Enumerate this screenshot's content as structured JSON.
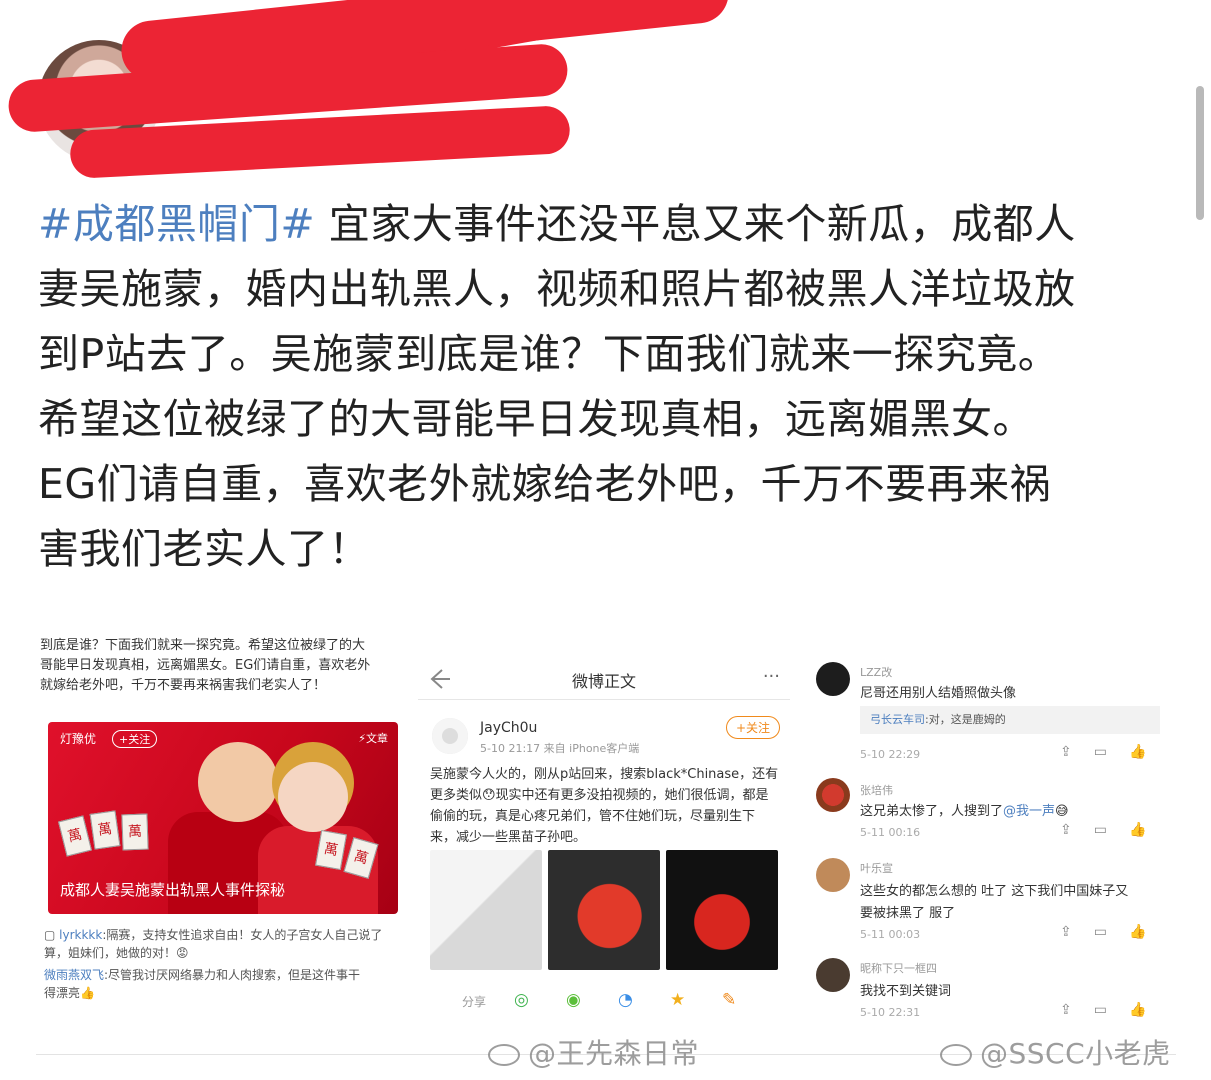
{
  "post": {
    "hashtag": "#成都黑帽门#",
    "lines": [
      " 宜家大事件还没平息又来个新瓜，成都人",
      "妻吴施蒙，婚内出轨黑人，视频和照片都被黑人洋垃圾放",
      "到P站去了。吴施蒙到底是谁？下面我们就来一探究竟。",
      "希望这位被绿了的大哥能早日发现真相，远离媚黑女。",
      "EG们请自重，喜欢老外就嫁给老外吧，千万不要再来祸",
      "害我们老实人了！"
    ]
  },
  "panel_article": {
    "lead_lines": [
      "到底是谁？下面我们就来一探究竟。希望这位被绿了的大",
      "哥能早日发现真相，远离媚黑女。EG们请自重，喜欢老外",
      "就嫁给老外吧，千万不要再来祸害我们老实人了！"
    ],
    "author": "灯豫优",
    "follow": "+关注",
    "tag": "⚡文章",
    "caption": "成都人妻吴施蒙出轨黑人事件探秘",
    "comments": [
      {
        "nick": "lyrkkkk",
        "text": ":隔赛，支持女性追求自由！女人的子宫女人自己说了",
        "text2": "算，姐妹们，她做的对！😡"
      },
      {
        "nick": "微雨燕双飞",
        "text": ":尽管我讨厌网络暴力和人肉搜索，但是这件事干",
        "text2": "得漂亮👍"
      }
    ]
  },
  "panel_weibo": {
    "nav_title": "微博正文",
    "more": "···",
    "poster_name": "JayCh0u",
    "poster_meta": "5-10 21:17  来自 iPhone客户端",
    "follow_label": "+关注",
    "body": "吴施蒙今人火的，刚从p站回来，搜索black*Chinase，还有更多类似😯现实中还有更多没拍视频的，她们很低调，都是偷偷的玩，真是心疼兄弟们，管不住她们玩，尽量别生下来，减少一些黑苗子孙吧。",
    "share_label": "分享"
  },
  "panel_comments": {
    "items": [
      {
        "nick": "LZZ改",
        "text": "尼哥还用别人结婚照做头像",
        "reply_nick": "弓长云车司",
        "reply_text": ":对，这是鹿姆的",
        "time": "5-10 22:29"
      },
      {
        "nick": "张培伟",
        "text": "这兄弟太惨了，人搜到了",
        "mention": "@我一声",
        "time": "5-11 00:16"
      },
      {
        "nick": "叶乐宣",
        "text": "这些女的都怎么想的 吐了 这下我们中国妹子又",
        "text2": "要被抹黑了 服了",
        "time": "5-11 00:03"
      },
      {
        "nick": "昵称下只一框四",
        "text": "我找不到关键词",
        "time": "5-10 22:31"
      }
    ]
  },
  "watermarks": [
    "@王先森日常",
    "@SSCC小老虎"
  ]
}
